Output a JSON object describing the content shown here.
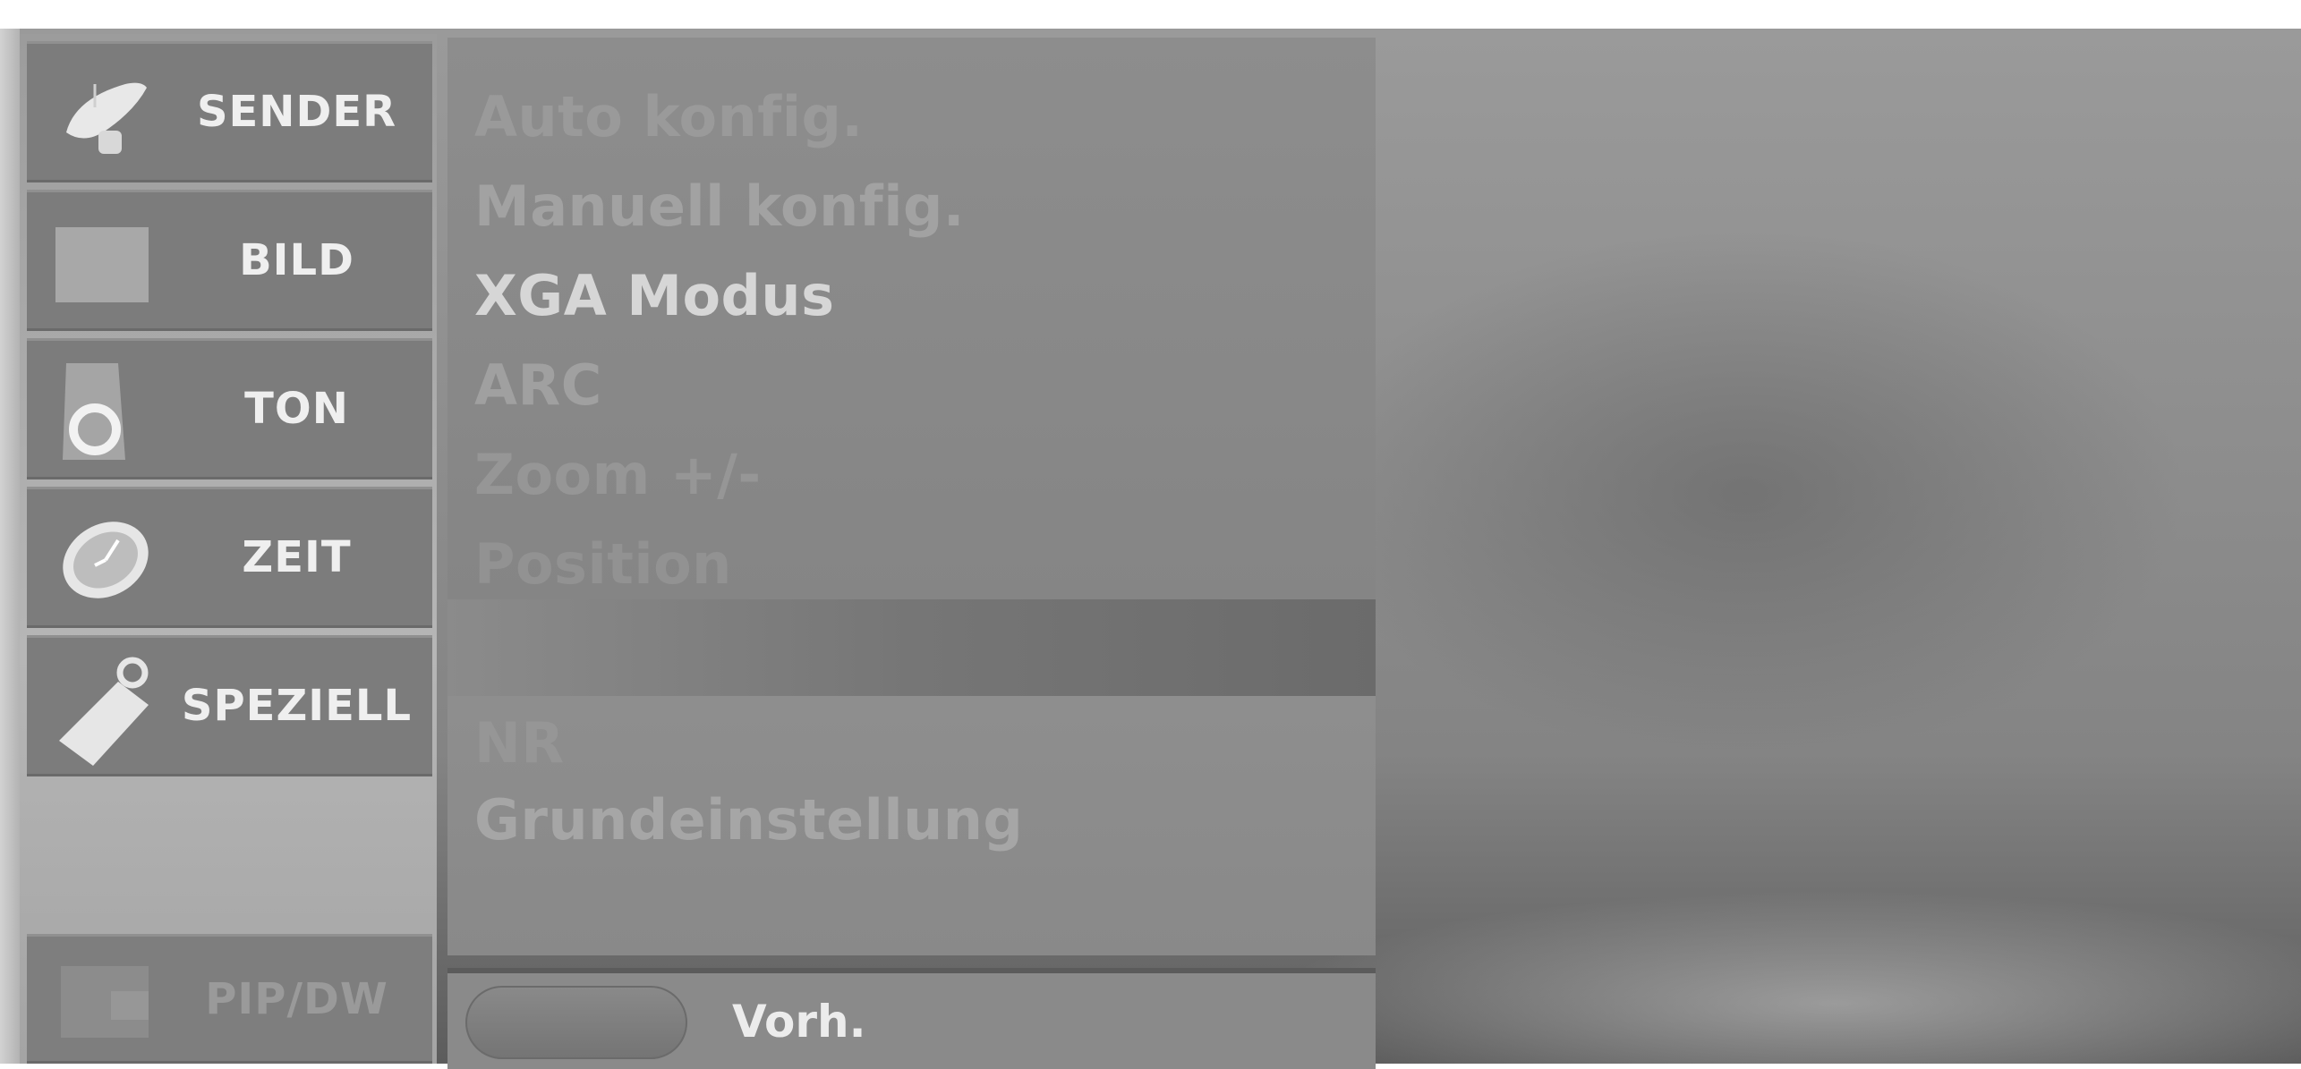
{
  "sidebar": {
    "items": [
      {
        "label": "SENDER",
        "icon": "satellite-dish-icon"
      },
      {
        "label": "BILD",
        "icon": "picture-icon"
      },
      {
        "label": "TON",
        "icon": "speaker-icon"
      },
      {
        "label": "ZEIT",
        "icon": "clock-icon"
      },
      {
        "label": "SPEZIELL",
        "icon": "tag-icon"
      },
      {
        "label": "PIP/DW",
        "icon": "pip-icon"
      }
    ]
  },
  "menu": {
    "items": [
      {
        "label": "Auto konfig."
      },
      {
        "label": "Manuell konfig."
      },
      {
        "label": "XGA Modus"
      },
      {
        "label": "ARC"
      },
      {
        "label": "Zoom +/-"
      },
      {
        "label": "Position"
      }
    ],
    "lower_items": [
      {
        "label": "NR"
      },
      {
        "label": "Grundeinstellung"
      }
    ]
  },
  "footer": {
    "button_label": "Vorh."
  },
  "colors": {
    "menu_text_bright": "#d6d6d6",
    "menu_text_dim": "#a2a2a2",
    "menu_text_faint": "#969696",
    "sidebar_tile": "#7c7c7c",
    "sidebar_text": "#efefef"
  }
}
